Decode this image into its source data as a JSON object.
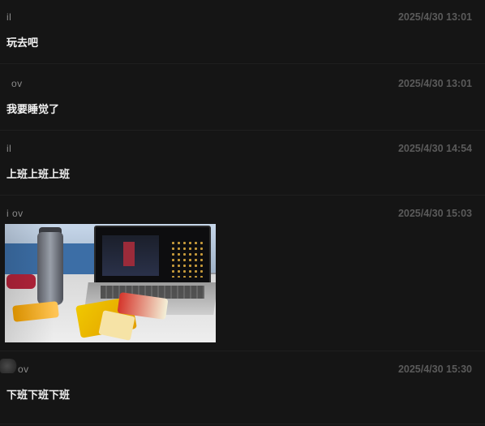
{
  "messages": [
    {
      "sender": "il",
      "time": "2025/4/30 13:01",
      "text": "玩去吧",
      "type": "text"
    },
    {
      "sender": "ov",
      "time": "2025/4/30 13:01",
      "text": "我要睡觉了",
      "type": "text"
    },
    {
      "sender": "il",
      "time": "2025/4/30 14:54",
      "text": "上班上班上班",
      "type": "text"
    },
    {
      "sender": "i ov",
      "time": "2025/4/30 15:03",
      "text": "",
      "type": "image",
      "image_alt": "desk photo with laptop, bottle and snacks"
    },
    {
      "sender": "ov",
      "time": "2025/4/30 15:30",
      "text": "下班下班下班",
      "type": "text"
    }
  ],
  "colors": {
    "background": "#151515",
    "text": "#f2f2f2",
    "timestamp": "#5a5a5a",
    "sender": "#8a8a8a"
  }
}
